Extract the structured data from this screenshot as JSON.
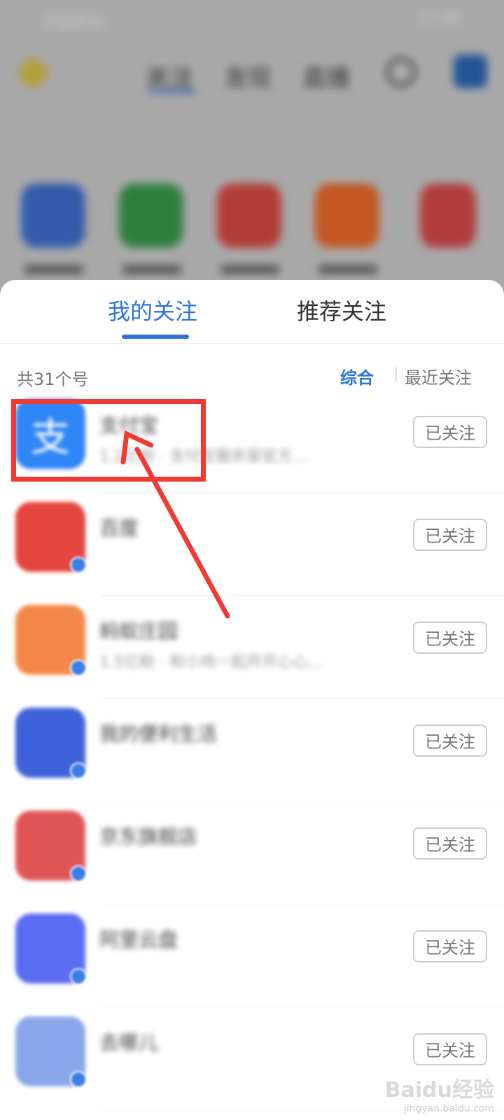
{
  "status_bar": {
    "carrier": "中国移动",
    "time": "13:46"
  },
  "top_nav": {
    "tabs": [
      {
        "label": "关注"
      },
      {
        "label": "发现"
      },
      {
        "label": "直播"
      }
    ]
  },
  "sheet": {
    "tabs": [
      {
        "label": "我的关注"
      },
      {
        "label": "推荐关注"
      }
    ],
    "count_label": "共31个号",
    "sort_options": [
      {
        "label": "综合"
      },
      {
        "label": "最近关注"
      }
    ],
    "accounts": [
      {
        "name": "支付宝",
        "desc": "1.2亿粉 · 支付宝服务窗官方...",
        "follow_label": "已关注",
        "color": "#2f86f6",
        "glyph": "支"
      },
      {
        "name": "百度",
        "desc": "",
        "follow_label": "已关注",
        "color": "#e3463e",
        "glyph": ""
      },
      {
        "name": "蚂蚁庄园",
        "desc": "1.5亿粉 · 和小鸡一起开开心心...",
        "follow_label": "已关注",
        "color": "#f3884a",
        "glyph": ""
      },
      {
        "name": "我的便利生活",
        "desc": "",
        "follow_label": "已关注",
        "color": "#3d62d9",
        "glyph": ""
      },
      {
        "name": "京东旗舰店",
        "desc": "",
        "follow_label": "已关注",
        "color": "#e05656",
        "glyph": ""
      },
      {
        "name": "阿里云盘",
        "desc": "",
        "follow_label": "已关注",
        "color": "#5a6cf2",
        "glyph": ""
      },
      {
        "name": "去哪儿",
        "desc": "",
        "follow_label": "已关注",
        "color": "#8aa6e8",
        "glyph": ""
      }
    ]
  },
  "watermark": {
    "logo": "Baidu经验",
    "url": "jingyan.baidu.com"
  },
  "colors": {
    "accent": "#2d74d8",
    "annotation": "#f03a36"
  }
}
